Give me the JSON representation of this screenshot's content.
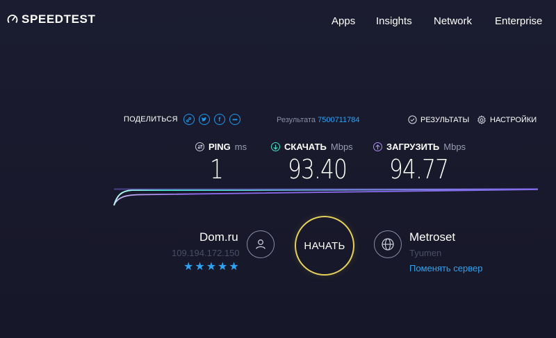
{
  "header": {
    "logo_text": "SPEEDTEST",
    "nav": [
      "Apps",
      "Insights",
      "Network",
      "Enterprise"
    ]
  },
  "share": {
    "label": "ПОДЕЛИТЬСЯ",
    "icons": [
      "link-icon",
      "twitter-icon",
      "facebook-icon",
      "more-icon"
    ]
  },
  "result": {
    "label": "Результата",
    "id": "7500711784"
  },
  "links": {
    "results": "РЕЗУЛЬТАТЫ",
    "settings": "НАСТРОЙКИ"
  },
  "metrics": {
    "ping": {
      "label": "PING",
      "unit": "ms",
      "value": "1"
    },
    "download": {
      "label": "СКАЧАТЬ",
      "unit": "Mbps",
      "value": "93.40"
    },
    "upload": {
      "label": "ЗАГРУЗИТЬ",
      "unit": "Mbps",
      "value": "94.77"
    }
  },
  "isp": {
    "name": "Dom.ru",
    "ip": "109.194.172.150",
    "rating_stars": 5
  },
  "go_button": "НАЧАТЬ",
  "server": {
    "name": "Metroset",
    "city": "Tyumen",
    "change_label": "Поменять сервер"
  },
  "colors": {
    "accent_blue": "#2ea3f2",
    "download_line": "#42e8c9",
    "upload_line": "#8f6bf0",
    "go_ring": "#e6d25a",
    "background": "#1a1a2e"
  }
}
